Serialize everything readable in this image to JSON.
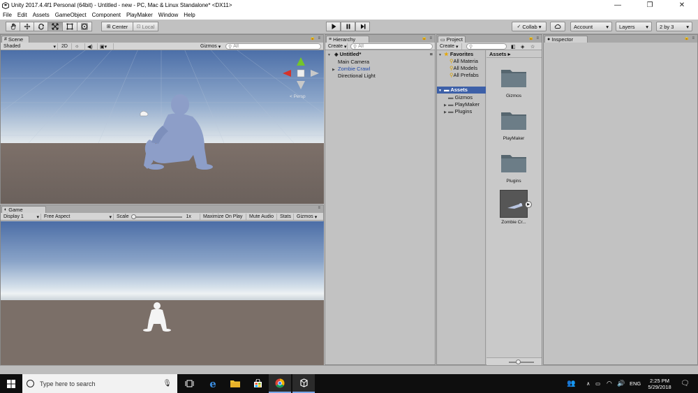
{
  "window": {
    "title": "Unity 2017.4.4f1 Personal (64bit) - Untitled - new - PC, Mac & Linux Standalone* <DX11>",
    "minimize_glyph": "—",
    "maximize_glyph": "❐",
    "close_glyph": "✕"
  },
  "menu": [
    "File",
    "Edit",
    "Assets",
    "GameObject",
    "Component",
    "PlayMaker",
    "Window",
    "Help"
  ],
  "toolbar": {
    "pivot_label": "Center",
    "space_label": "Local",
    "collab_label": "Collab ▾",
    "account_label": "Account",
    "layers_label": "Layers",
    "layout_label": "2 by 3",
    "dropdown_glyph": "▾"
  },
  "scene": {
    "tab_label": "Scene",
    "shading_mode": "Shaded",
    "mode_2d": "2D",
    "gizmos_label": "Gizmos",
    "search_placeholder": "All",
    "projection_label": "< Persp"
  },
  "game": {
    "tab_label": "Game",
    "display_label": "Display 1",
    "aspect_label": "Free Aspect",
    "scale_label": "Scale",
    "scale_value": "1x",
    "maximize_label": "Maximize On Play",
    "mute_label": "Mute Audio",
    "stats_label": "Stats",
    "gizmos_label": "Gizmos"
  },
  "hierarchy": {
    "tab_label": "Hierarchy",
    "create_label": "Create",
    "search_placeholder": "All",
    "scene_name": "Untitled*",
    "items": [
      {
        "label": "Main Camera"
      },
      {
        "label": "Zombie Crawl"
      },
      {
        "label": "Directional Light"
      }
    ],
    "prefab_color": "#1f49a8"
  },
  "project": {
    "tab_label": "Project",
    "create_label": "Create",
    "favorites_label": "Favorites",
    "favorites": [
      "All Materia",
      "All Models",
      "All Prefabs"
    ],
    "assets_root": "Assets",
    "tree": [
      "Gizmos",
      "PlayMaker",
      "Plugins"
    ],
    "breadcrumb": "Assets ▸",
    "grid": [
      {
        "label": "Gizmos",
        "icon": "folder-icon"
      },
      {
        "label": "PlayMaker",
        "icon": "folder-icon"
      },
      {
        "label": "Plugins",
        "icon": "folder-icon"
      },
      {
        "label": "Zombie Cr...",
        "icon": "model-icon"
      }
    ],
    "zoom_fraction": 0.38
  },
  "inspector": {
    "tab_label": "Inspector"
  },
  "taskbar": {
    "search_placeholder": "Type here to search",
    "language": "ENG",
    "time": "2:25 PM",
    "date": "5/29/2018"
  }
}
